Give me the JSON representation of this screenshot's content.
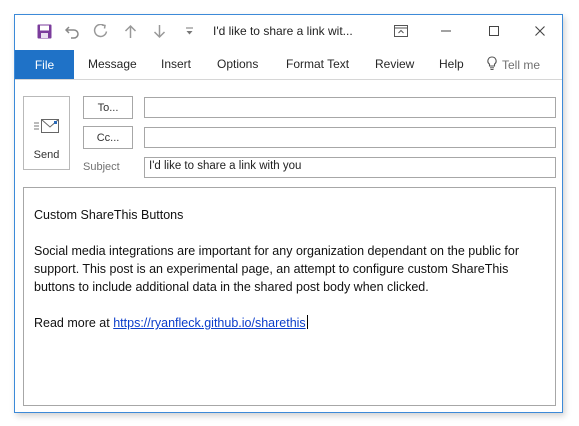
{
  "window": {
    "title": "I'd like to share a link wit..."
  },
  "quick_access": {
    "icons": [
      "save-icon",
      "undo-icon",
      "redo-icon",
      "up-arrow-icon",
      "down-arrow-icon",
      "customize-icon"
    ]
  },
  "ribbon": {
    "file_label": "File",
    "tabs": [
      "Message",
      "Insert",
      "Options",
      "Format Text",
      "Review",
      "Help"
    ],
    "tell_me": "Tell me"
  },
  "compose": {
    "send_label": "Send",
    "to_label": "To...",
    "cc_label": "Cc...",
    "to_value": "",
    "cc_value": "",
    "subject_label": "Subject",
    "subject_value": "I'd like to share a link with you"
  },
  "message": {
    "heading": "Custom ShareThis Buttons",
    "paragraph": "Social media integrations are important for any organization dependant on the public for support. This post is an experimental page, an attempt to configure custom ShareThis buttons to include additional data in the shared post body when clicked.",
    "read_more_prefix": "Read more at ",
    "link_text": "https://ryanfleck.github.io/sharethis"
  },
  "colors": {
    "accent": "#1f72c7",
    "link": "#0b3dca",
    "save_icon": "#7b3c9c"
  }
}
